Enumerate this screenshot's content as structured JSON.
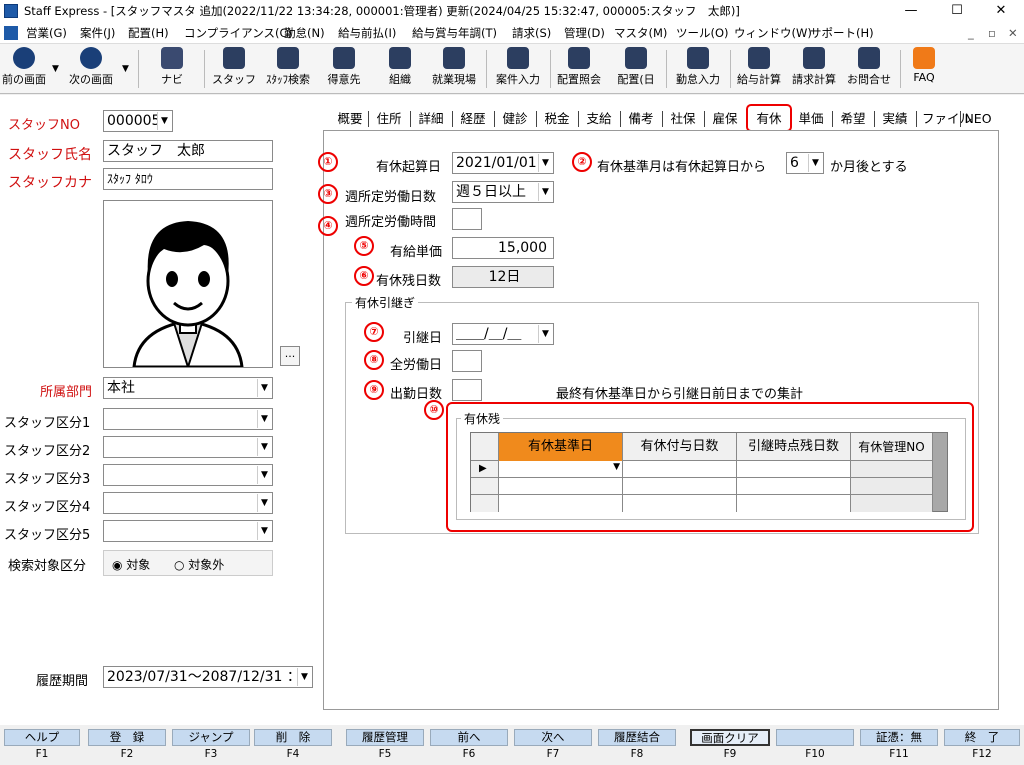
{
  "window": {
    "icon": "app-icon",
    "title": "Staff Express - [スタッフマスタ 追加(2022/11/22 13:34:28, 000001:管理者) 更新(2024/04/25 15:32:47, 000005:スタッフ　太郎)]",
    "minimize": "—",
    "maximize": "☐",
    "close": "✕"
  },
  "menu": [
    "営業(G)",
    "案件(J)",
    "配置(H)",
    "コンプライアンス(C)",
    "勤怠(N)",
    "給与前払(I)",
    "給与賞与年調(T)",
    "請求(S)",
    "管理(D)",
    "マスタ(M)",
    "ツール(O)",
    "ウィンドウ(W)",
    "サポート(H)"
  ],
  "menu_right": {
    "min": "_",
    "restore": "▫",
    "close": "✕"
  },
  "toolbar": {
    "prev": "前の画面",
    "next": "次の画面",
    "navi": "ナビ",
    "staff": "スタッフ",
    "staff_search": "ｽﾀｯﾌ検索",
    "client": "得意先",
    "org": "組織",
    "site": "就業現場",
    "job": "案件入力",
    "assign": "配置照会",
    "assign_day": "配置(日",
    "attend": "勤怠入力",
    "payroll": "給与計算",
    "billing": "請求計算",
    "inquiry": "お問合せ",
    "faq": "FAQ"
  },
  "left": {
    "staff_no_label": "スタッフNO",
    "staff_no": "000005",
    "name_label": "スタッフ氏名",
    "name": "スタッフ　太郎",
    "kana_label": "スタッフカナ",
    "kana": "ｽﾀｯﾌ ﾀﾛｳ",
    "photo_btn": "...",
    "dept_label": "所属部門",
    "dept": "本社",
    "kubun1": "スタッフ区分1",
    "kubun2": "スタッフ区分2",
    "kubun3": "スタッフ区分3",
    "kubun4": "スタッフ区分4",
    "kubun5": "スタッフ区分5",
    "search_label": "検索対象区分",
    "opt_target": "対象",
    "opt_exclude": "対象外",
    "history_label": "履歴期間",
    "history": "2023/07/31～2087/12/31 ："
  },
  "tabs": [
    "概要",
    "住所",
    "詳細",
    "経歴",
    "健診",
    "税金",
    "支給",
    "備考",
    "社保",
    "雇保",
    "有休",
    "単価",
    "希望",
    "実績",
    "ファイル",
    "NEO"
  ],
  "form": {
    "n1": "①",
    "n2": "②",
    "n3": "③",
    "n4": "④",
    "n5": "⑤",
    "n6": "⑥",
    "n7": "⑦",
    "n8": "⑧",
    "n9": "⑨",
    "n10": "⑩",
    "start_label": "有休起算日",
    "start": "2021/01/01",
    "base_pre": "有休基準月は有休起算日から",
    "base_months": "6",
    "base_post": "か月後とする",
    "weekdays_label": "週所定労働日数",
    "weekdays": "週５日以上",
    "weekhours_label": "週所定労働時間",
    "weekhours": "",
    "unit_label": "有給単価",
    "unit": "15,000",
    "remain_label": "有休残日数",
    "remain": "12日",
    "carry_title": "有休引継ぎ",
    "carry_date_label": "引継日",
    "carry_date": "＿＿/＿/＿",
    "all_days_label": "全労働日",
    "all_days": "",
    "attend_label": "出勤日数",
    "attend": "",
    "attend_note": "最終有休基準日から引継日前日までの集計",
    "remain_title": "有休残",
    "cols": [
      "有休基準日",
      "有休付与日数",
      "引継時点残日数",
      "有休管理NO"
    ]
  },
  "fkeys": [
    {
      "label": "ヘルプ",
      "key": "F1"
    },
    {
      "label": "登　録",
      "key": "F2"
    },
    {
      "label": "ジャンプ",
      "key": "F3"
    },
    {
      "label": "削　除",
      "key": "F4"
    },
    {
      "label": "履歴管理",
      "key": "F5"
    },
    {
      "label": "前へ",
      "key": "F6"
    },
    {
      "label": "次へ",
      "key": "F7"
    },
    {
      "label": "履歴結合",
      "key": "F8"
    },
    {
      "label": "画面クリア",
      "key": "F9"
    },
    {
      "label": "",
      "key": "F10"
    },
    {
      "label": "証憑：無",
      "key": "F11"
    },
    {
      "label": "終　了",
      "key": "F12"
    }
  ],
  "colors": {
    "label_red": "#d01010",
    "annot_red": "#e00000",
    "grid_header": "#f08a1c",
    "fkey": "#c6daf0"
  }
}
